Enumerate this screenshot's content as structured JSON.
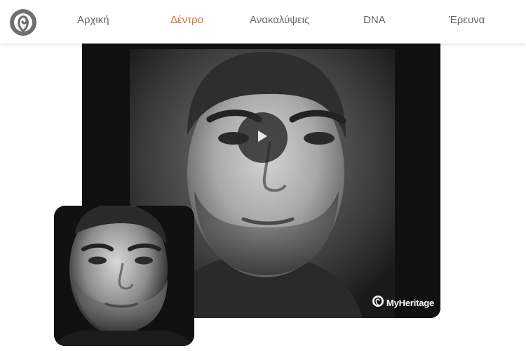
{
  "nav": {
    "logo_icon": "myheritage-logo-icon",
    "items": [
      {
        "label": "Αρχική",
        "active": false
      },
      {
        "label": "Δέντρο",
        "active": true
      },
      {
        "label": "Ανακαλύψεις",
        "active": false
      },
      {
        "label": "DNA",
        "active": false
      },
      {
        "label": "Έρευνα",
        "active": false
      }
    ]
  },
  "video": {
    "play_icon": "play-icon",
    "watermark": "MyHeritage"
  },
  "thumbnail": {
    "icon": "portrait-photo-icon"
  },
  "colors": {
    "accent": "#e0653a",
    "nav_text": "#666666",
    "video_bg": "#101010"
  }
}
